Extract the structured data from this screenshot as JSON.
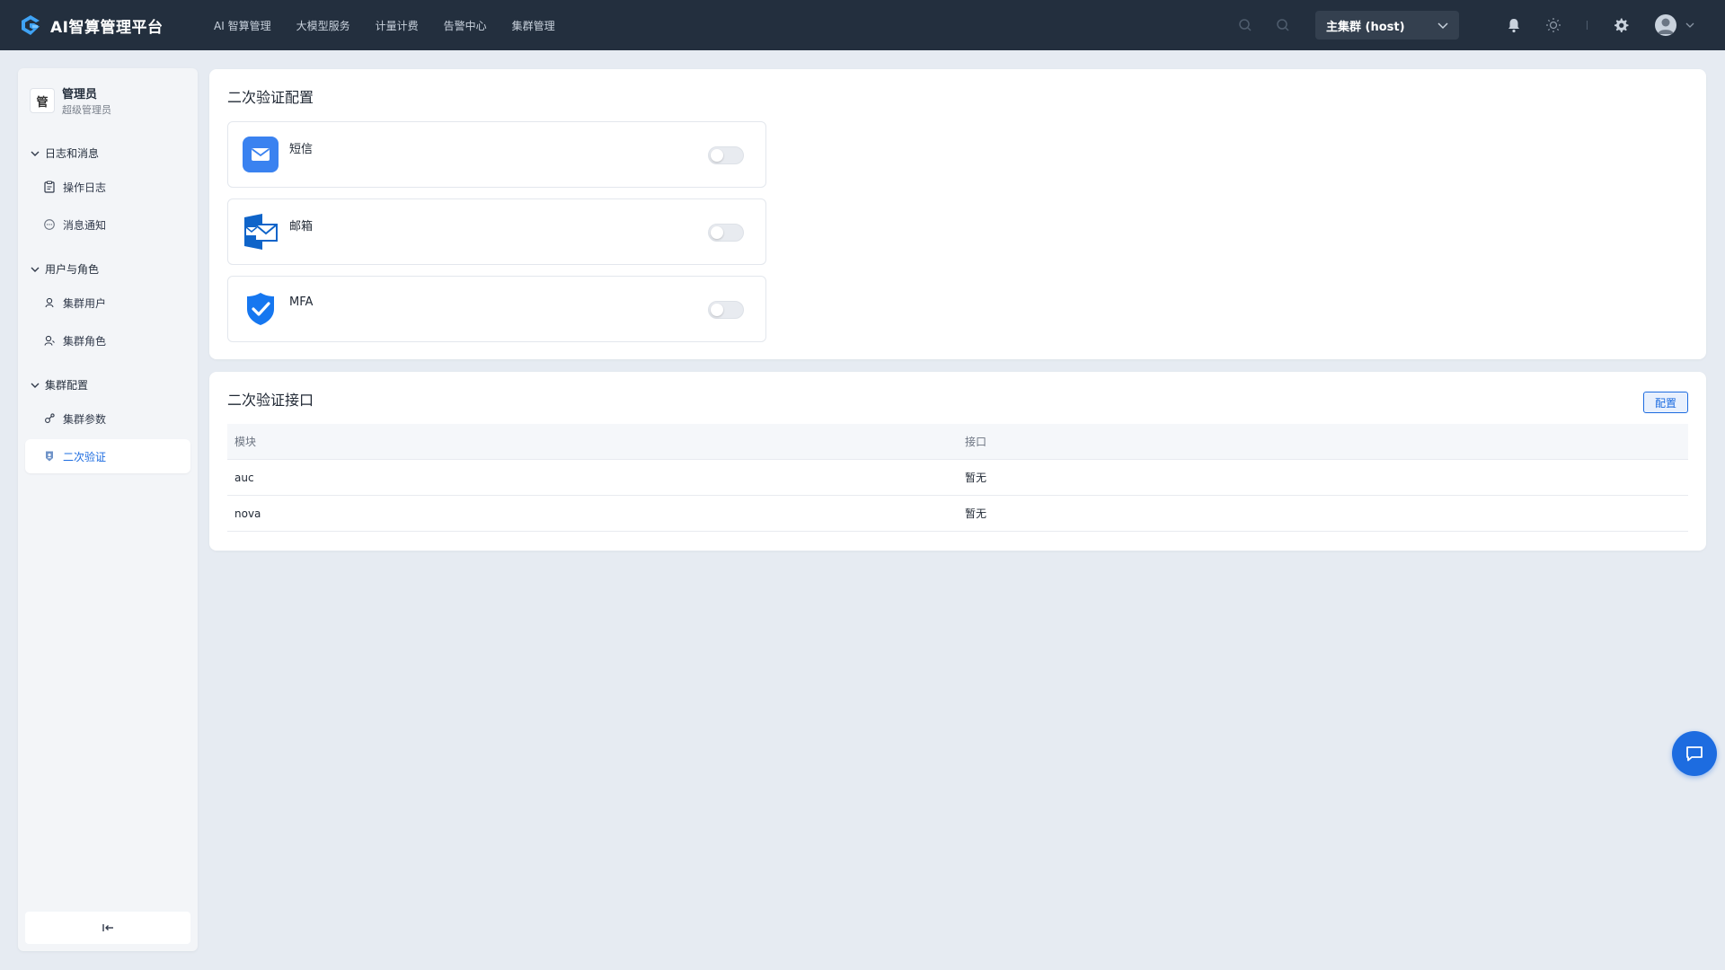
{
  "app": {
    "title": "AI智算管理平台"
  },
  "nav": {
    "items": [
      "AI 智算管理",
      "大模型服务",
      "计量计费",
      "告警中心",
      "集群管理"
    ]
  },
  "cluster_select": {
    "value": "主集群 (host)"
  },
  "user": {
    "avatar_text": "管",
    "name": "管理员",
    "role": "超级管理员"
  },
  "sidebar": {
    "groups": [
      {
        "label": "日志和消息",
        "items": [
          {
            "label": "操作日志",
            "icon": "clipboard-icon"
          },
          {
            "label": "消息通知",
            "icon": "message-icon"
          }
        ]
      },
      {
        "label": "用户与角色",
        "items": [
          {
            "label": "集群用户",
            "icon": "user-icon"
          },
          {
            "label": "集群角色",
            "icon": "role-icon"
          }
        ]
      },
      {
        "label": "集群配置",
        "items": [
          {
            "label": "集群参数",
            "icon": "params-icon"
          },
          {
            "label": "二次验证",
            "icon": "verify-icon"
          }
        ]
      }
    ],
    "active_item": "二次验证",
    "collapse_icon": "collapse-left-icon"
  },
  "verify_config": {
    "title": "二次验证配置",
    "methods": [
      {
        "label": "短信",
        "icon": "sms-icon",
        "enabled": false
      },
      {
        "label": "邮箱",
        "icon": "outlook-mail-icon",
        "enabled": false
      },
      {
        "label": "MFA",
        "icon": "shield-check-icon",
        "enabled": false
      }
    ]
  },
  "verify_api": {
    "title": "二次验证接口",
    "config_button": "配置",
    "columns": [
      "模块",
      "接口"
    ],
    "rows": [
      [
        "auc",
        "暂无"
      ],
      [
        "nova",
        "暂无"
      ]
    ]
  },
  "colors": {
    "topbar": "#232f3e",
    "accent": "#1d6ce0",
    "page_bg": "#e6ebf2"
  }
}
